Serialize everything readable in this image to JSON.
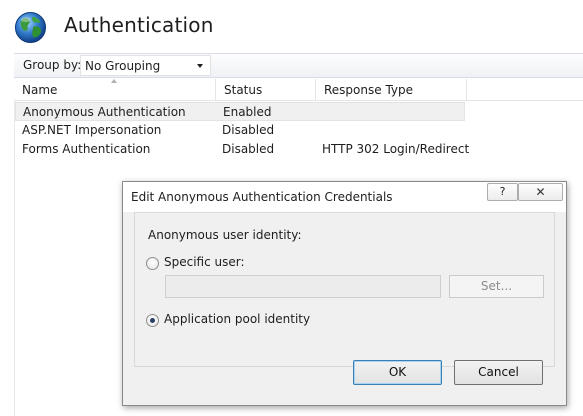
{
  "header": {
    "title": "Authentication",
    "icon": "globe-icon"
  },
  "group_bar": {
    "label": "Group by:",
    "selected": "No Grouping"
  },
  "table": {
    "columns": [
      "Name",
      "Status",
      "Response Type"
    ],
    "rows": [
      {
        "name": "Anonymous Authentication",
        "status": "Enabled",
        "response": ""
      },
      {
        "name": "ASP.NET Impersonation",
        "status": "Disabled",
        "response": ""
      },
      {
        "name": "Forms Authentication",
        "status": "Disabled",
        "response": "HTTP 302 Login/Redirect"
      }
    ],
    "selected_row_index": 0
  },
  "dialog": {
    "title": "Edit Anonymous Authentication Credentials",
    "help_label": "?",
    "close_label": "✕",
    "section_label": "Anonymous user identity:",
    "option_specific_user": "Specific user:",
    "specific_user_value": "",
    "set_button": "Set...",
    "option_app_pool": "Application pool identity",
    "selected_option": "Application pool identity",
    "ok_button": "OK",
    "cancel_button": "Cancel"
  }
}
